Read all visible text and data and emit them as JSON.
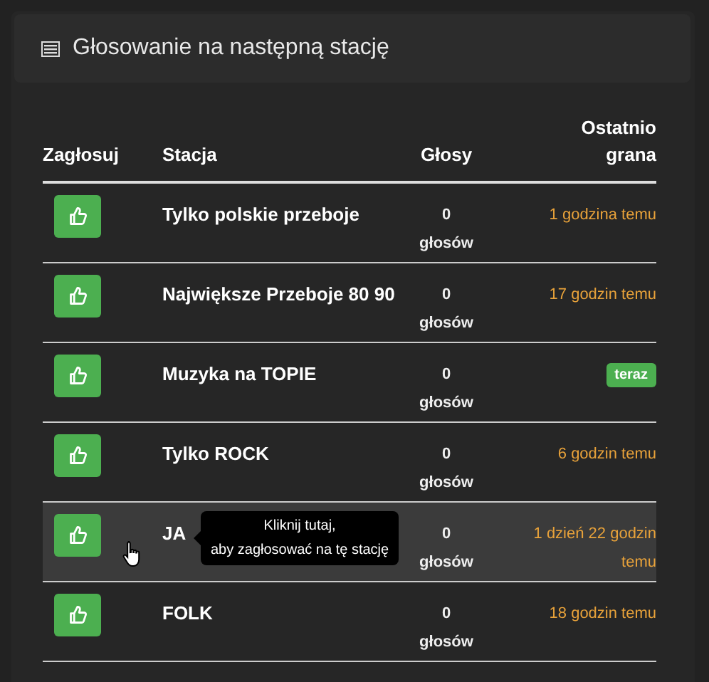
{
  "panel": {
    "title": "Głosowanie na następną stację"
  },
  "table": {
    "columns": [
      "Zagłosuj",
      "Stacja",
      "Głosy",
      "Ostatnio grana"
    ],
    "rows": [
      {
        "station": "Tylko polskie przeboje",
        "votes": "0",
        "votes_unit": "głosów",
        "last_played": "1 godzina temu",
        "kind": "time",
        "hovered": false
      },
      {
        "station": "Największe Przeboje 80 90",
        "votes": "0",
        "votes_unit": "głosów",
        "last_played": "17 godzin temu",
        "kind": "time",
        "hovered": false
      },
      {
        "station": "Muzyka na TOPIE",
        "votes": "0",
        "votes_unit": "głosów",
        "last_played": "teraz",
        "kind": "badge",
        "hovered": false
      },
      {
        "station": "Tylko ROCK",
        "votes": "0",
        "votes_unit": "głosów",
        "last_played": "6 godzin temu",
        "kind": "time",
        "hovered": false
      },
      {
        "station": "JA",
        "votes": "0",
        "votes_unit": "głosów",
        "last_played": "1 dzień 22 godzin temu",
        "kind": "time",
        "hovered": true
      },
      {
        "station": "FOLK",
        "votes": "0",
        "votes_unit": "głosów",
        "last_played": "18 godzin temu",
        "kind": "time",
        "hovered": false
      }
    ]
  },
  "tooltip": {
    "lines": [
      "Kliknij tutaj,",
      "aby zagłosować na tę stację"
    ]
  }
}
